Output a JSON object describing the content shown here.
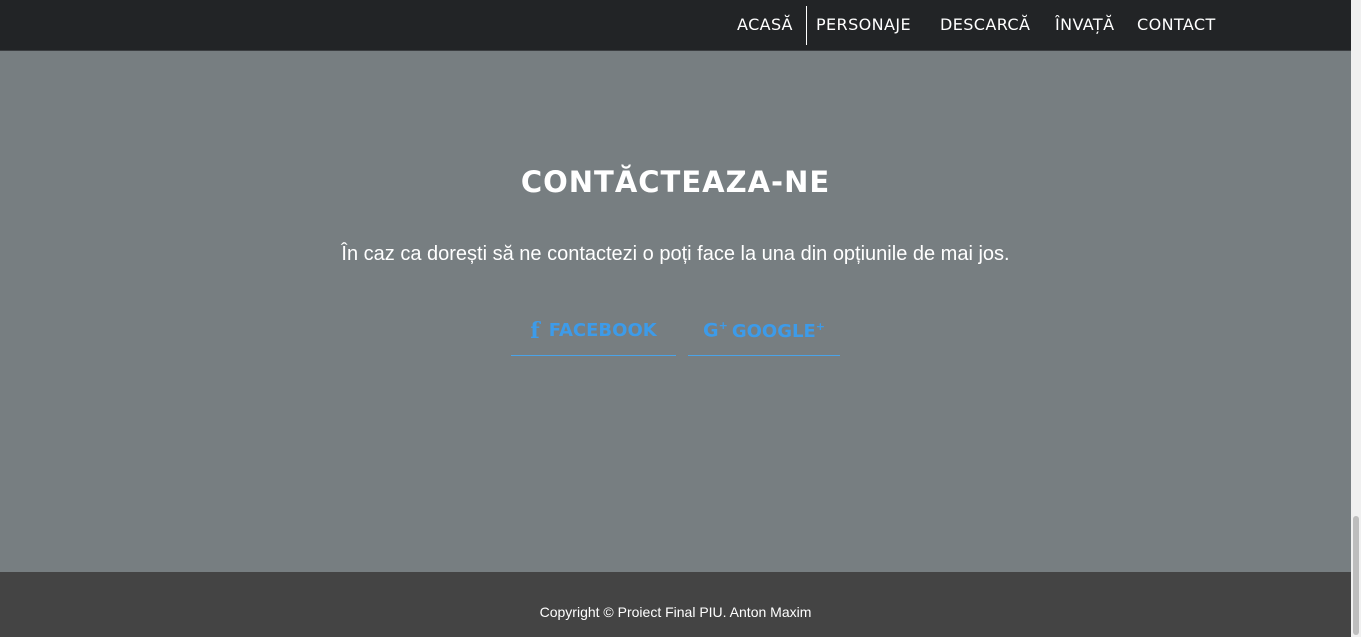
{
  "nav": {
    "items": [
      {
        "label": "ACASĂ"
      },
      {
        "label": "PERSONAJE"
      },
      {
        "label": "DESCARCĂ"
      },
      {
        "label": "ÎNVAȚĂ"
      },
      {
        "label": "CONTACT"
      }
    ]
  },
  "contact": {
    "title": "CONTĂCTEAZA-NE",
    "text": "În caz ca dorești să ne contactezi o poți face la una din opțiunile de mai jos.",
    "buttons": [
      {
        "label": "FACEBOOK",
        "icon": "facebook-icon"
      },
      {
        "label": "GOOGLE",
        "label_suffix": "+",
        "icon": "google-plus-icon"
      }
    ]
  },
  "footer": {
    "copyright": "Copyright © Proiect Final PIU. Anton Maxim"
  },
  "colors": {
    "navbar": "#222426",
    "section": "#777e81",
    "accent": "#3d9be9",
    "footer": "#444444"
  }
}
